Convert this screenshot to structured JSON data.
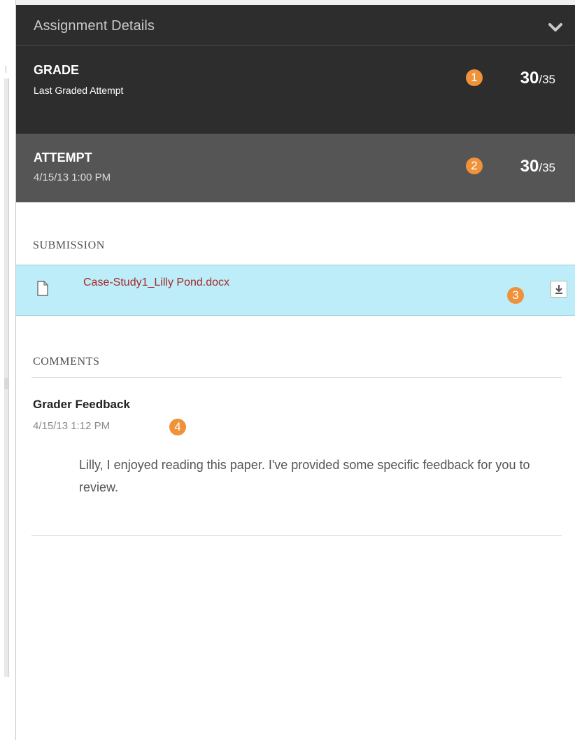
{
  "panel": {
    "header_title": "Assignment Details",
    "header_icon": "chevron-down-icon"
  },
  "grade": {
    "title": "GRADE",
    "subtitle": "Last Graded Attempt",
    "badge": "1",
    "score": "30",
    "total": "/35"
  },
  "attempt": {
    "title": "ATTEMPT",
    "date": "4/15/13 1:00 PM",
    "badge": "2",
    "score": "30",
    "total": "/35"
  },
  "submission": {
    "label": "SUBMISSION",
    "file_icon": "document-icon",
    "file_name": "Case-Study1_Lilly Pond.docx",
    "badge": "3",
    "download_icon": "download-icon"
  },
  "comments": {
    "label": "COMMENTS",
    "feedback_title": "Grader Feedback",
    "feedback_date": "4/15/13 1:12 PM",
    "badge": "4",
    "feedback_text": "Lilly, I enjoyed reading this paper. I've provided some specific feedback for you to review."
  },
  "colors": {
    "header_bg": "#2d2d2d",
    "attempt_bg": "#555555",
    "badge": "#f0923a",
    "submission_highlight": "#bcedf8",
    "file_link": "#a52a2a"
  }
}
